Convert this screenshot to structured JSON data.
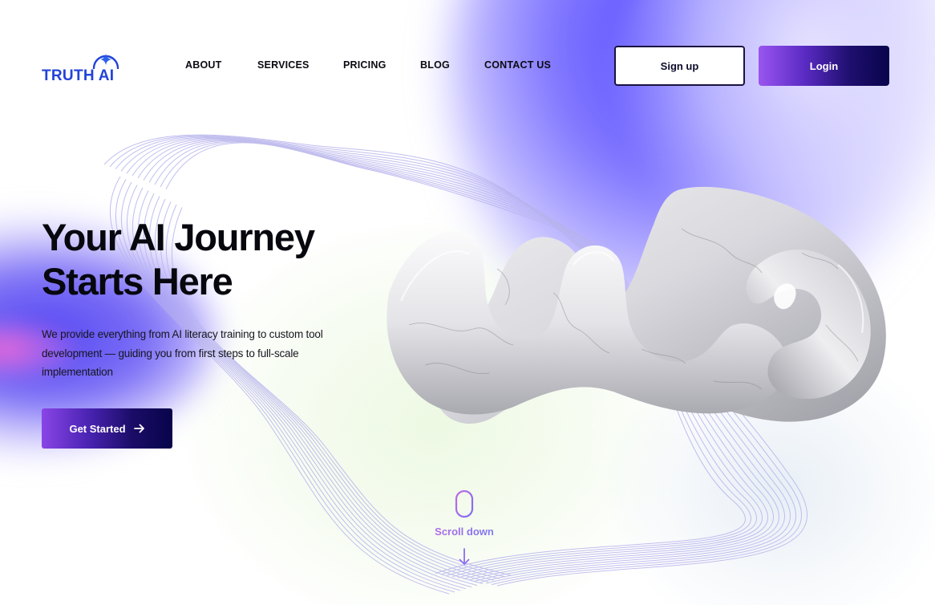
{
  "brand": {
    "logo_text": "TRUTH AI",
    "logo_icon": "sparkle-circle-icon",
    "color": "#2243d8"
  },
  "nav": {
    "items": [
      {
        "label": "ABOUT"
      },
      {
        "label": "SERVICES"
      },
      {
        "label": "PRICING"
      },
      {
        "label": "BLOG"
      },
      {
        "label": "CONTACT US"
      }
    ]
  },
  "auth": {
    "signup_label": "Sign up",
    "login_label": "Login"
  },
  "hero": {
    "title_line1": "Your AI Journey",
    "title_line2": "Starts Here",
    "subtitle": "We provide everything from AI literacy training to custom tool development — guiding you from first steps to full-scale implementation",
    "cta_label": "Get Started",
    "cta_icon": "arrow-right-icon"
  },
  "scroll": {
    "label": "Scroll down",
    "icon_top": "mouse-icon",
    "icon_bottom": "arrow-down-icon"
  },
  "colors": {
    "accent_purple": "#9b55f0",
    "accent_navy": "#08044b",
    "background_blue": "#5b50ff"
  }
}
